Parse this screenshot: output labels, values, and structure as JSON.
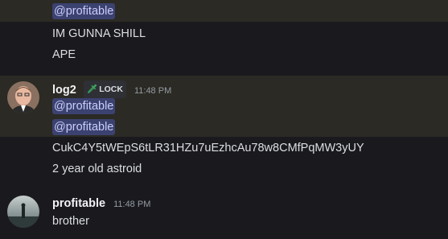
{
  "messages": [
    {
      "mention": "@profitable",
      "lines": [
        "IM GUNNA SHILL",
        "APE"
      ]
    },
    {
      "username": "log2",
      "tag_icon": "sword-icon",
      "tag": "LOCK",
      "timestamp": "11:48 PM",
      "mentions": [
        "@profitable",
        "@profitable"
      ],
      "lines": [
        "CukC4Y5tWEpS6tLR31HZu7uEzhcAu78w8CMfPqMW3yUY",
        "2 year old astroid"
      ]
    },
    {
      "username": "profitable",
      "timestamp": "11:48 PM",
      "lines": [
        "brother"
      ]
    }
  ],
  "colors": {
    "background": "#1a1a1e",
    "highlight": "#2b2a24",
    "mention_bg": "#3c4270",
    "mention_text": "#c9cdfb"
  }
}
